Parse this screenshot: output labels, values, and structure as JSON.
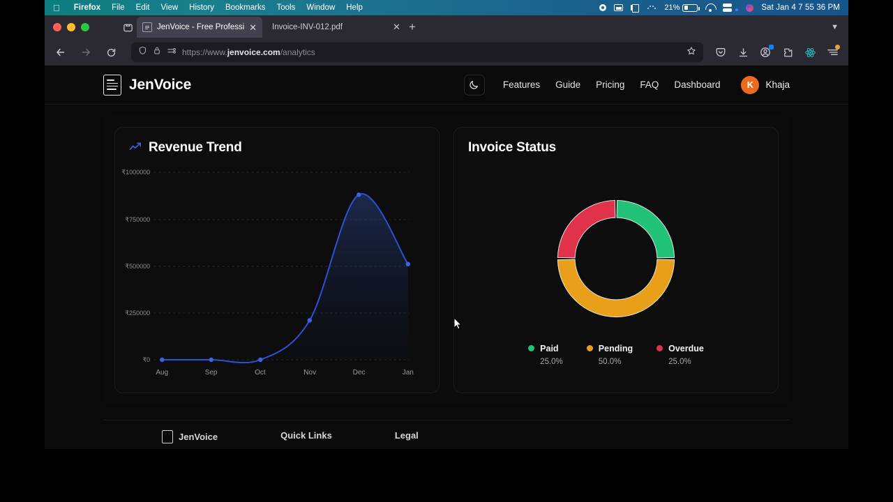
{
  "os_menubar": {
    "apple_icon": "apple-icon",
    "items": [
      "Firefox",
      "File",
      "Edit",
      "View",
      "History",
      "Bookmarks",
      "Tools",
      "Window",
      "Help"
    ],
    "status_icons": [
      "record-icon",
      "control-center-icon",
      "screen-mirroring-icon",
      "dots-icon",
      "battery-icon",
      "wifi-icon",
      "server-icon",
      "siri-icon"
    ],
    "battery_percent": "21%",
    "clock": "Sat Jan 4  7 55 36 PM"
  },
  "browser": {
    "window_controls": [
      "close",
      "minimize",
      "maximize"
    ],
    "list_all_tabs_icon": "list-all-tabs-icon",
    "tabs": [
      {
        "title": "JenVoice - Free Professional Inv",
        "favicon": "document-icon",
        "active": true,
        "close_icon": "close-icon"
      },
      {
        "title": "Invoice-INV-012.pdf",
        "active": false,
        "close_icon": "close-icon"
      }
    ],
    "new_tab_label": "+",
    "tab_overflow_icon": "chevron-down-icon",
    "nav": {
      "back_icon": "back-arrow-icon",
      "forward_icon": "forward-arrow-icon",
      "reload_icon": "reload-icon"
    },
    "url": {
      "shield_icon": "shield-icon",
      "lock_icon": "lock-icon",
      "permissions_icon": "page-permissions-icon",
      "scheme": "https://www.",
      "domain": "jenvoice.com",
      "path": "/analytics",
      "full": "https://www.jenvoice.com/analytics",
      "bookmark_icon": "star-icon"
    },
    "toolbar_icons": [
      "pocket-icon",
      "downloads-icon",
      "account-icon",
      "extension-icon",
      "react-devtools-icon",
      "app-menu-icon"
    ]
  },
  "site": {
    "brand": "JenVoice",
    "brand_logo_icon": "invoice-document-icon",
    "theme_toggle_icon": "moon-icon",
    "nav_links": [
      "Features",
      "Guide",
      "Pricing",
      "FAQ",
      "Dashboard"
    ],
    "user": {
      "initial": "K",
      "name": "Khaja",
      "avatar_color": "#ea6a1e"
    }
  },
  "cards": {
    "revenue": {
      "title": "Revenue Trend",
      "icon": "trending-up-icon"
    },
    "status": {
      "title": "Invoice Status"
    }
  },
  "footer": {
    "brand": "JenVoice",
    "quick_links_title": "Quick Links",
    "legal_title": "Legal"
  },
  "chart_data": [
    {
      "type": "line",
      "title": "Revenue Trend",
      "categories": [
        "Aug",
        "Sep",
        "Oct",
        "Nov",
        "Dec",
        "Jan"
      ],
      "values": [
        0,
        0,
        0,
        210000,
        880000,
        510000
      ],
      "ytick_labels": [
        "₹1000000",
        "₹750000",
        "₹500000",
        "₹250000",
        "₹0"
      ],
      "ytick_values": [
        1000000,
        750000,
        500000,
        250000,
        0
      ],
      "ylim": [
        0,
        1000000
      ],
      "xlabel": "",
      "ylabel": "",
      "grid": true,
      "line_color": "#2f50d8",
      "point_color": "#3b62e8",
      "area_fill": "#15224a",
      "legend": "none"
    },
    {
      "type": "pie",
      "title": "Invoice Status",
      "donut": true,
      "labels": [
        "Paid",
        "Pending",
        "Overdue"
      ],
      "values": [
        25.0,
        50.0,
        25.0
      ],
      "value_labels": [
        "25.0%",
        "50.0%",
        "25.0%"
      ],
      "colors": [
        "#22c278",
        "#e8a01a",
        "#e0324b"
      ],
      "legend": "bottom"
    }
  ]
}
